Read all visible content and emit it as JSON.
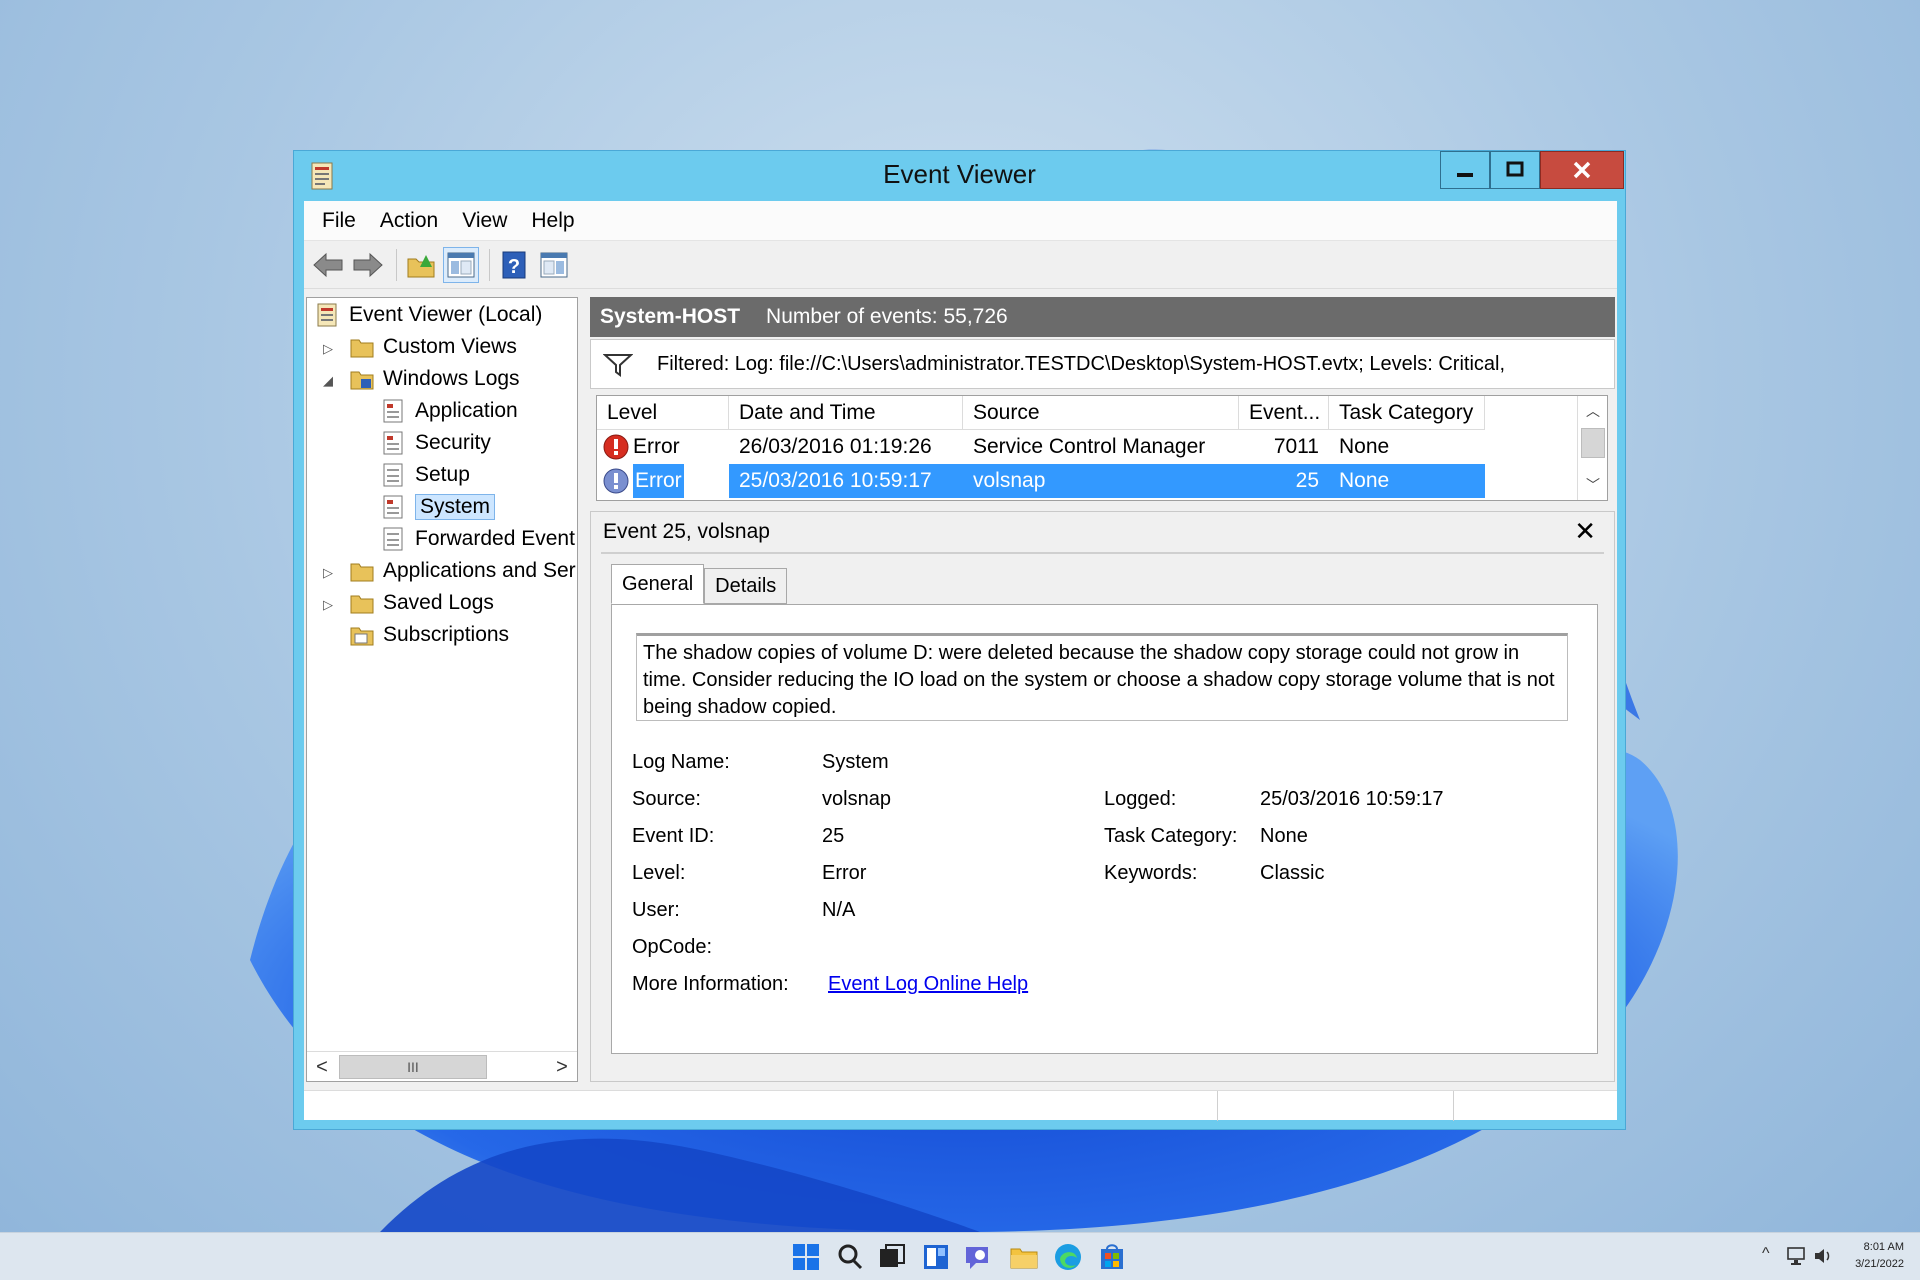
{
  "window": {
    "title": "Event Viewer",
    "controls": {
      "minimize": "minimize",
      "maximize": "maximize",
      "close": "close"
    }
  },
  "menu": [
    "File",
    "Action",
    "View",
    "Help"
  ],
  "toolbar": {
    "icons": [
      "back-arrow-icon",
      "forward-arrow-icon",
      "open-folder-icon",
      "show-hide-console-tree-icon",
      "help-icon",
      "action-pane-icon"
    ]
  },
  "tree": {
    "root": "Event Viewer (Local)",
    "custom_views": "Custom Views",
    "windows_logs": "Windows Logs",
    "application": "Application",
    "security": "Security",
    "setup": "Setup",
    "system": "System",
    "forwarded": "Forwarded Event",
    "apps_services": "Applications and Ser",
    "saved_logs": "Saved Logs",
    "subscriptions": "Subscriptions",
    "scroll_thumb": "III",
    "scroll_left": "<",
    "scroll_right": ">"
  },
  "log_header": {
    "name": "System-HOST",
    "count": "Number of events: 55,726"
  },
  "filter": {
    "text": "Filtered: Log: file://C:\\Users\\administrator.TESTDC\\Desktop\\System-HOST.evtx; Levels: Critical,"
  },
  "events": {
    "columns": [
      "Level",
      "Date and Time",
      "Source",
      "Event...",
      "Task Category"
    ],
    "rows": [
      {
        "level": "Error",
        "datetime": "26/03/2016 01:19:26",
        "source": "Service Control Manager",
        "id": "7011",
        "category": "None",
        "selected": false
      },
      {
        "level": "Error",
        "datetime": "25/03/2016 10:59:17",
        "source": "volsnap",
        "id": "25",
        "category": "None",
        "selected": true
      }
    ]
  },
  "detail": {
    "title": "Event 25, volsnap",
    "tabs": [
      "General",
      "Details"
    ],
    "description": "The shadow copies of volume D: were deleted because the shadow copy storage could not grow in time.  Consider reducing the IO load on the system or choose a shadow copy storage volume that is not being shadow copied.",
    "labels": {
      "log_name": "Log Name:",
      "source": "Source:",
      "event_id": "Event ID:",
      "level": "Level:",
      "user": "User:",
      "opcode": "OpCode:",
      "more_info": "More Information:",
      "logged": "Logged:",
      "task_category": "Task Category:",
      "keywords": "Keywords:"
    },
    "values": {
      "log_name": "System",
      "source": "volsnap",
      "event_id": "25",
      "level": "Error",
      "user": "N/A",
      "opcode": "",
      "more_info": "Event Log Online Help",
      "logged": "25/03/2016 10:59:17",
      "task_category": "None",
      "keywords": "Classic"
    }
  },
  "taskbar": {
    "icons": [
      "start-icon",
      "search-icon",
      "task-view-icon",
      "widgets-icon",
      "chat-icon",
      "file-explorer-icon",
      "edge-icon",
      "store-icon"
    ],
    "time": "8:01 AM",
    "date": "3/21/2022",
    "tray_chevron": "^"
  },
  "colors": {
    "window_frame": "#6ccbee",
    "close_button": "#c74b3f",
    "selection": "#3399ff",
    "header_bar": "#6b6b6b",
    "error_red": "#d62d20",
    "link": "#0000ee"
  }
}
